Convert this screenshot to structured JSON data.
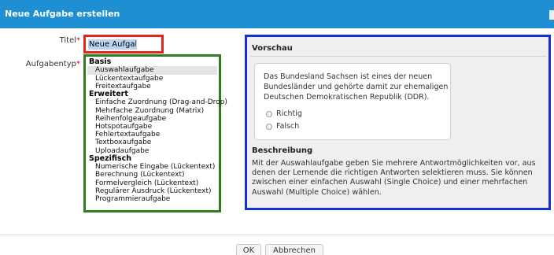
{
  "dialog": {
    "title": "Neue Aufgabe erstellen"
  },
  "form": {
    "title_label": "Titel",
    "required_mark": "*",
    "title_value": "Neue Aufgabe",
    "type_label": "Aufgabentyp",
    "groups": [
      {
        "label": "Basis",
        "items": [
          "Auswahlaufgabe",
          "Lückentextaufgabe",
          "Freitextaufgabe"
        ]
      },
      {
        "label": "Erweitert",
        "items": [
          "Einfache Zuordnung (Drag-and-Drop)",
          "Mehrfache Zuordnung (Matrix)",
          "Reihenfolgeaufgabe",
          "Hotspotaufgabe",
          "Fehlertextaufgabe",
          "Textboxaufgabe",
          "Uploadaufgabe"
        ]
      },
      {
        "label": "Spezifisch",
        "items": [
          "Numerische Eingabe (Lückentext)",
          "Berechnung (Lückentext)",
          "Formelvergleich (Lückentext)",
          "Regulärer Ausdruck (Lückentext)",
          "Programmieraufgabe"
        ]
      }
    ],
    "selected_item": "Auswahlaufgabe"
  },
  "preview": {
    "heading": "Vorschau",
    "question": "Das Bundesland Sachsen ist eines der neuen Bundesländer und gehörte damit zur ehemaligen Deutschen Demokratischen Republik (DDR).",
    "options": [
      "Richtig",
      "Falsch"
    ],
    "description_heading": "Beschreibung",
    "description": "Mit der Auswahlaufgabe geben Sie mehrere Antwortmöglichkeiten vor, aus denen der Lernende die richtigen Antworten selektieren muss. Sie können zwischen einer einfachen Auswahl (Single Choice) und einer mehrfachen Auswahl (Multiple Choice) wählen."
  },
  "footer": {
    "ok_label": "OK",
    "cancel_label": "Abbrechen"
  },
  "colors": {
    "header": "#1f8fd4",
    "title_highlight": "#e1261c",
    "list_highlight": "#2e7c1f",
    "preview_highlight": "#1330d6"
  }
}
